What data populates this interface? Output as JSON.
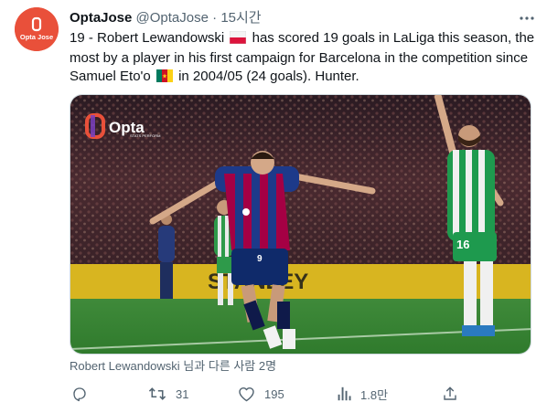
{
  "tweet": {
    "display_name": "OptaJose",
    "handle": "@OptaJose",
    "separator": "·",
    "time": "15시간",
    "avatar_text": "Opta Jose",
    "text_part1": "19 - Robert Lewandowski",
    "text_part2": "has scored 19 goals in LaLiga this season, the most by a player in his first campaign for Barcelona in the competition since Samuel Eto'o",
    "text_part3": "in 2004/05 (24 goals). Hunter.",
    "flag_poland": "flag-poland",
    "flag_cameroon": "flag-cameroon"
  },
  "media": {
    "logo_text": "Opta",
    "logo_sub": "STATS PERFORM",
    "board_text": "STANLEY",
    "jersey_front": "9",
    "jersey_back": "16",
    "sponsor": "Spotify"
  },
  "tags": "Robert Lewandowski 님과 다른 사람 2명",
  "actions": {
    "reply": {
      "icon": "reply-icon",
      "count": ""
    },
    "retweet": {
      "icon": "retweet-icon",
      "count": "31"
    },
    "like": {
      "icon": "like-icon",
      "count": "195"
    },
    "views": {
      "icon": "views-icon",
      "count": "1.8만"
    },
    "share": {
      "icon": "share-icon",
      "count": ""
    }
  },
  "colors": {
    "avatar": "#e9503a",
    "text": "#0f1419",
    "secondary": "#536471",
    "border": "#cfd9de"
  }
}
